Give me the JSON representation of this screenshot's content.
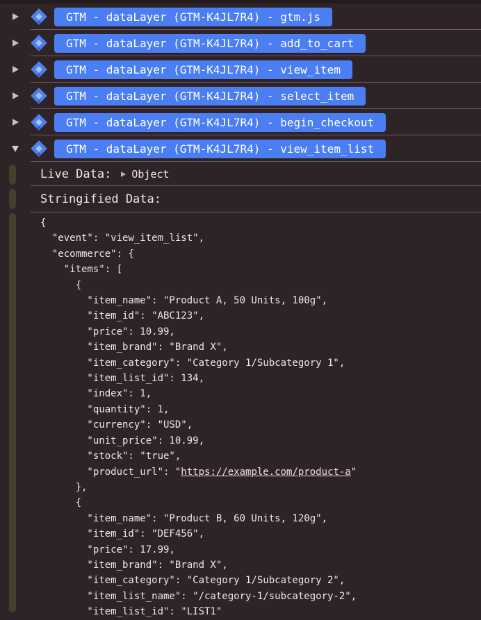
{
  "header_rows": [
    {
      "label": "GTM - dataLayer (GTM-K4JL7R4) - gtm.js",
      "state": "collapsed"
    },
    {
      "label": "GTM - dataLayer (GTM-K4JL7R4) - add_to_cart",
      "state": "collapsed"
    },
    {
      "label": "GTM - dataLayer (GTM-K4JL7R4) - view_item",
      "state": "collapsed"
    },
    {
      "label": "GTM - dataLayer (GTM-K4JL7R4) - select_item",
      "state": "collapsed"
    },
    {
      "label": "GTM - dataLayer (GTM-K4JL7R4) - begin_checkout",
      "state": "collapsed"
    },
    {
      "label": "GTM - dataLayer (GTM-K4JL7R4) - view_item_list",
      "state": "expanded"
    }
  ],
  "details": {
    "live_data_label": "Live Data:",
    "live_data_value": "Object",
    "stringified_data_label": "Stringified Data:"
  },
  "json_lines": [
    {
      "text": "{"
    },
    {
      "text": "  \"event\": \"view_item_list\","
    },
    {
      "text": "  \"ecommerce\": {"
    },
    {
      "text": "    \"items\": ["
    },
    {
      "text": "      {"
    },
    {
      "text": "        \"item_name\": \"Product A, 50 Units, 100g\","
    },
    {
      "text": "        \"item_id\": \"ABC123\","
    },
    {
      "text": "        \"price\": 10.99,"
    },
    {
      "text": "        \"item_brand\": \"Brand X\","
    },
    {
      "text": "        \"item_category\": \"Category 1/Subcategory 1\","
    },
    {
      "text": "        \"item_list_id\": 134,"
    },
    {
      "text": "        \"index\": 1,"
    },
    {
      "text": "        \"quantity\": 1,"
    },
    {
      "text": "        \"currency\": \"USD\","
    },
    {
      "text": "        \"unit_price\": 10.99,"
    },
    {
      "text": "        \"stock\": \"true\","
    },
    {
      "text": "        \"product_url\": \"",
      "link": "https://example.com/product-a",
      "suffix": "\""
    },
    {
      "text": "      },"
    },
    {
      "text": "      {"
    },
    {
      "text": "        \"item_name\": \"Product B, 60 Units, 120g\","
    },
    {
      "text": "        \"item_id\": \"DEF456\","
    },
    {
      "text": "        \"price\": 17.99,"
    },
    {
      "text": "        \"item_brand\": \"Brand X\","
    },
    {
      "text": "        \"item_category\": \"Category 1/Subcategory 2\","
    },
    {
      "text": "        \"item_list_name\": \"/category-1/subcategory-2\","
    },
    {
      "text": "        \"item_list_id\": \"LIST1\""
    }
  ],
  "colors": {
    "badge_blue": "#4b7ef3",
    "background": "#2e2428",
    "separator": "#6e5960",
    "gutter_marker": "#443e2b",
    "text": "#ece8e6",
    "gtm_icon_outer": "#4e81ee",
    "gtm_icon_inner": "#a7c4f8",
    "gtm_icon_tip": "#3160c6"
  }
}
